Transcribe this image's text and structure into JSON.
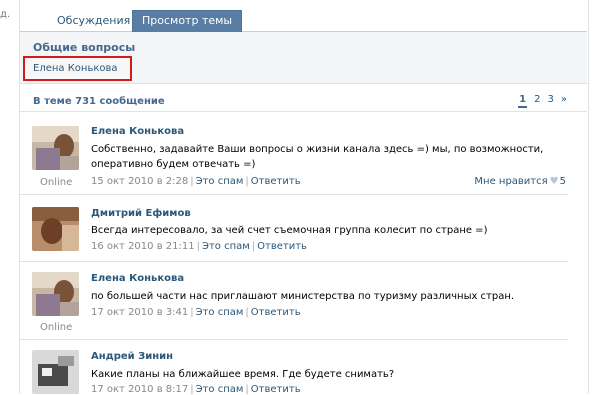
{
  "left_edge_text": "д.",
  "tabs": [
    {
      "label": "Обсуждения"
    },
    {
      "label": "Просмотр темы"
    }
  ],
  "topic": {
    "title": "Общие вопросы",
    "author": "Елена Конькова"
  },
  "count_text": "В теме 731 сообщение",
  "pager": [
    "1",
    "2",
    "3",
    "»"
  ],
  "posts": [
    {
      "author": "Елена Конькова",
      "text": "Собственно, задавайте Ваши вопросы о жизни канала здесь =) мы, по возможности, оперативно будем отвечать =)",
      "date": "15 окт 2010 в 2:28",
      "spam": "Это спам",
      "reply": "Ответить",
      "online": "Online",
      "like_label": "Мне нравится",
      "like_count": "5"
    },
    {
      "author": "Дмитрий Ефимов",
      "text": "Всегда интересовало, за чей счет съемочная группа колесит по стране =)",
      "date": "16 окт 2010 в 21:11",
      "spam": "Это спам",
      "reply": "Ответить"
    },
    {
      "author": "Елена Конькова",
      "text": "по большей части нас приглашают министерства по туризму различных стран.",
      "date": "17 окт 2010 в 3:41",
      "spam": "Это спам",
      "reply": "Ответить",
      "online": "Online"
    },
    {
      "author": "Андрей Зинин",
      "text": "Какие планы на ближайшее время. Где будете снимать?",
      "date": "17 окт 2010 в 8:17",
      "spam": "Это спам",
      "reply": "Ответить"
    }
  ],
  "colors": {
    "accent": "#597da3",
    "link": "#2b587a",
    "highlight_border": "#d11c1c"
  }
}
